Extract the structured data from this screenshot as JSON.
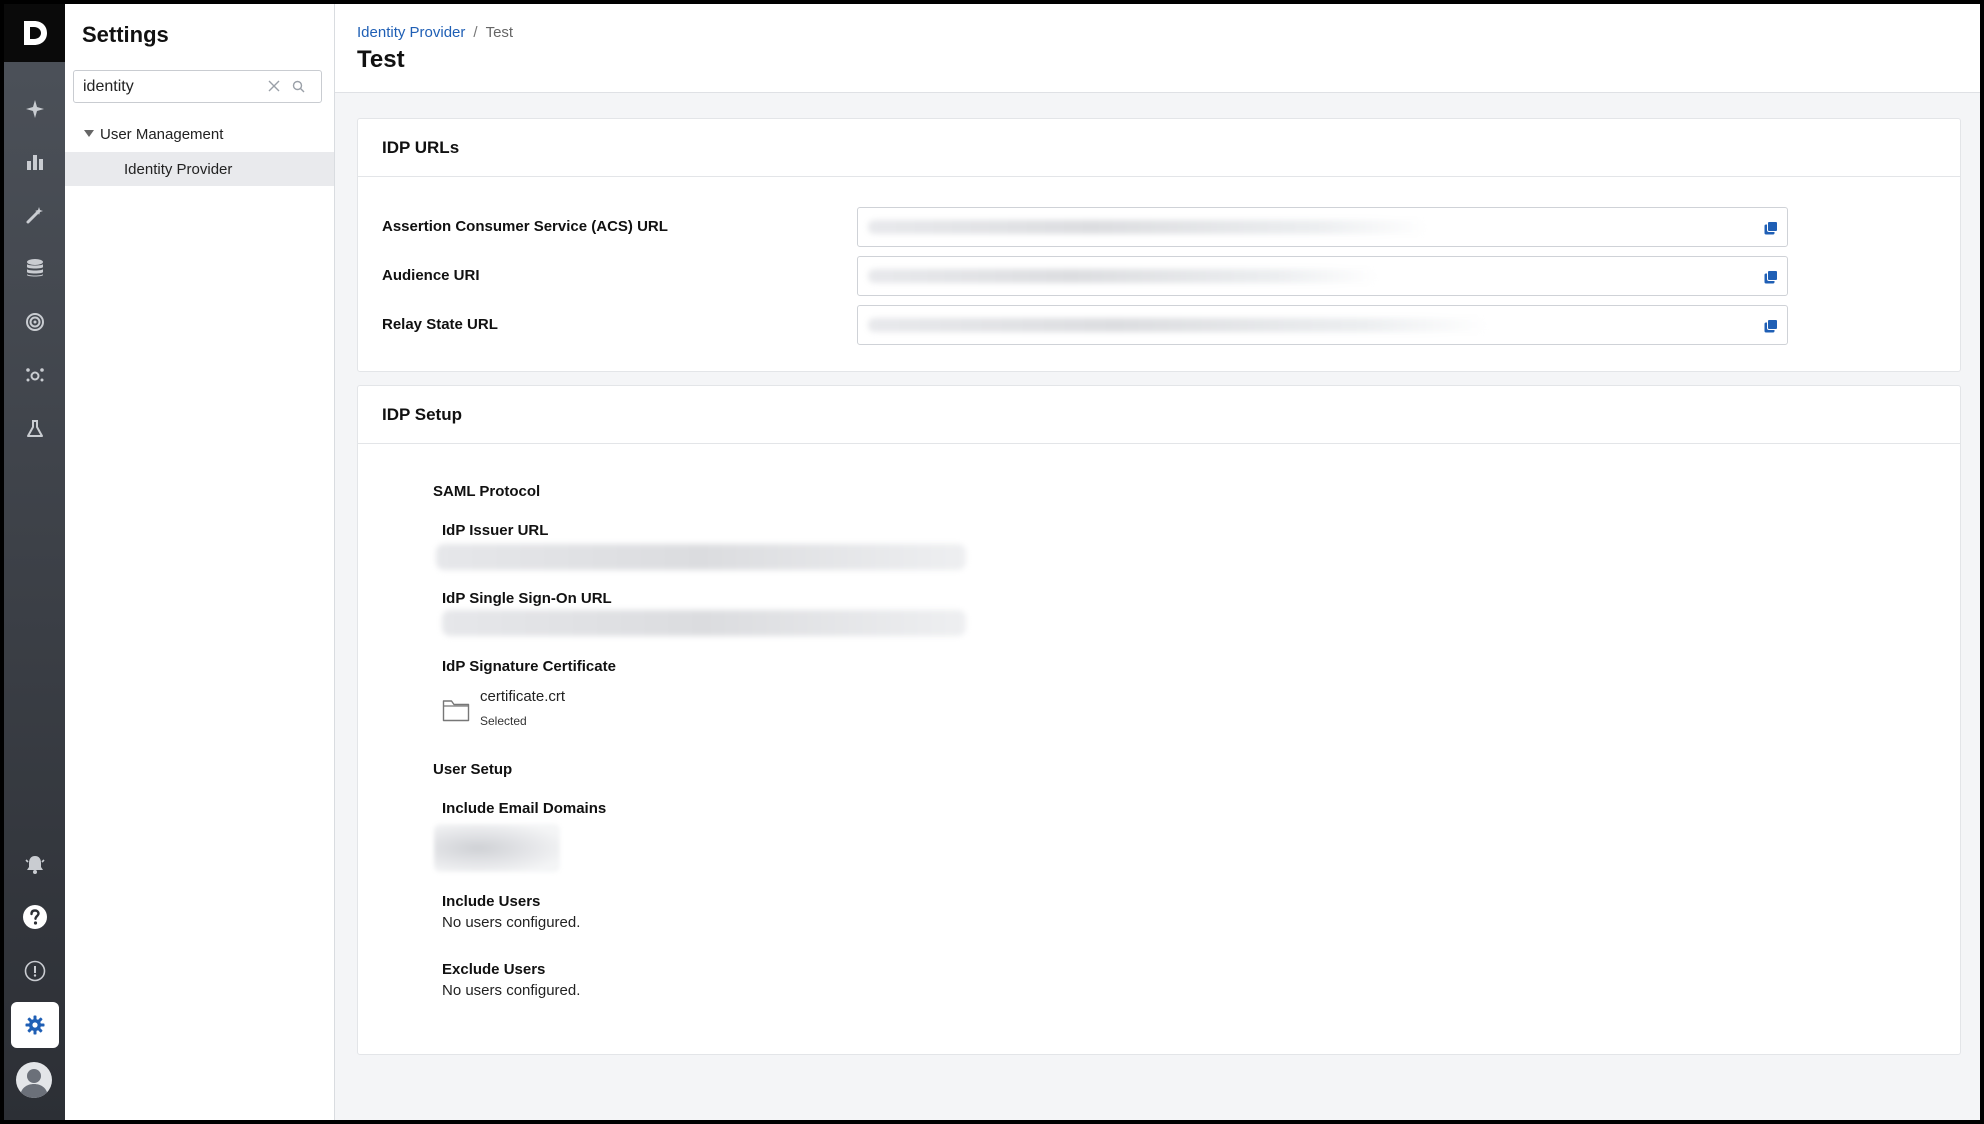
{
  "settings_panel": {
    "title": "Settings",
    "search": {
      "value": "identity",
      "placeholder": ""
    },
    "tree": {
      "group_label": "User Management",
      "item_label": "Identity Provider"
    }
  },
  "header": {
    "breadcrumb": [
      "Identity Provider",
      "Test"
    ],
    "breadcrumb_separator": "/",
    "title": "Test"
  },
  "idp_urls": {
    "title": "IDP URLs",
    "rows": [
      {
        "label": "Assertion Consumer Service (ACS) URL"
      },
      {
        "label": "Audience URI"
      },
      {
        "label": "Relay State URL"
      }
    ]
  },
  "idp_setup": {
    "title": "IDP Setup",
    "saml_section": "SAML Protocol",
    "issuer_label": "IdP Issuer URL",
    "sso_label": "IdP Single Sign-On URL",
    "certificate_label": "IdP Signature Certificate",
    "certificate_file": "certificate.crt",
    "certificate_status": "Selected",
    "user_setup_section": "User Setup",
    "include_domains_label": "Include Email Domains",
    "include_users_label": "Include Users",
    "include_users_value": "No users configured.",
    "exclude_users_label": "Exclude Users",
    "exclude_users_value": "No users configured."
  },
  "colors": {
    "accent": "#1f5fb5",
    "rail_top": "#4d525a",
    "rail_bottom": "#2c2f35"
  }
}
